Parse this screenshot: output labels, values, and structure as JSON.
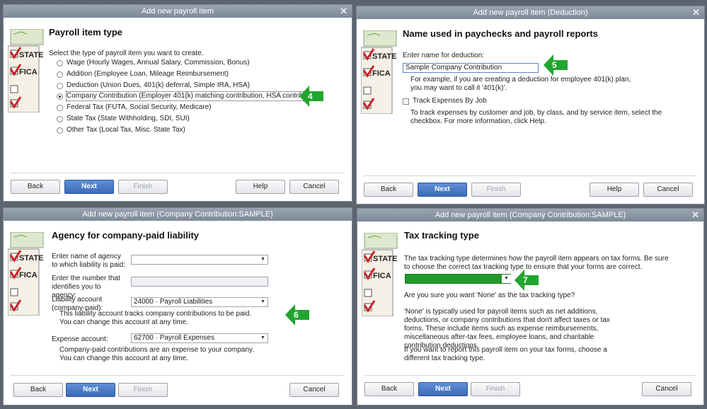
{
  "dialogs": {
    "d1": {
      "title": "Add new payroll item",
      "heading": "Payroll item type",
      "prompt": "Select the type of payroll item you want to create.",
      "options": [
        {
          "label": "Wage (Hourly Wages, Annual Salary, Commission, Bonus)"
        },
        {
          "label": "Addition (Employee Loan, Mileage Reimbursement)"
        },
        {
          "label": "Deduction (Union Dues, 401(k) deferral, Simple IRA, HSA)"
        },
        {
          "label": "Company Contribution (Employer 401(k) matching contribution, HSA contribution)"
        },
        {
          "label": "Federal Tax (FUTA, Social Security, Medicare)"
        },
        {
          "label": "State Tax (State Withholding, SDI, SUI)"
        },
        {
          "label": "Other Tax (Local Tax, Misc. State Tax)"
        }
      ],
      "selected_index": 3,
      "buttons": {
        "back": "Back",
        "next": "Next",
        "finish": "Finish",
        "help": "Help",
        "cancel": "Cancel"
      },
      "step": "4"
    },
    "d2": {
      "title": "Add new payroll item (Deduction)",
      "heading": "Name used in paychecks and payroll reports",
      "prompt": "Enter name for deduction:",
      "name_value": "Sample Company Contribution",
      "hint": "For example, if you are creating a deduction for employee 401(k) plan, you may want to call it '401(k)'.",
      "track_label": "Track Expenses By Job",
      "track_checked": false,
      "track_hint": "To track expenses by customer and job, by class, and by service item, select the checkbox. For more information, click Help.",
      "buttons": {
        "back": "Back",
        "next": "Next",
        "finish": "Finish",
        "help": "Help",
        "cancel": "Cancel"
      },
      "step": "5"
    },
    "d3": {
      "title": "Add new payroll item (Company Contribution:SAMPLE)",
      "heading": "Agency for company-paid liability",
      "agency_label": "Enter name of agency to which liability is paid:",
      "agency_value": "",
      "number_label": "Enter the number that identifies you to agency:",
      "number_value": "",
      "liability_label": "Liability account (company-paid):",
      "liability_value": "24000 · Payroll Liabilities",
      "liability_hint": "This liability account tracks company contributions to be paid. You can change this account at any time.",
      "expense_label": "Expense account:",
      "expense_value": "62700 · Payroll Expenses",
      "expense_hint": "Company-paid contributions are an expense to your company. You can change this account at any time.",
      "buttons": {
        "back": "Back",
        "next": "Next",
        "finish": "Finish",
        "cancel": "Cancel"
      },
      "step": "6"
    },
    "d4": {
      "title": "Add new payroll item (Company Contribution:SAMPLE)",
      "heading": "Tax tracking type",
      "intro": "The tax tracking type determines how the payroll item appears on tax forms. Be sure to choose the correct tax tracking type to ensure that your forms are correct.",
      "question": "Are you sure you want 'None' as the tax tracking type?",
      "explain": "'None' is typically used for payroll items such as net additions, deductions, or company contributions that don't affect taxes or tax forms. These include items such as expense reimbursements, miscellaneous after-tax fees, employee loans, and charitable contribution deductions.",
      "report": "If you want to report this payroll item on your tax forms, choose a different tax tracking type.",
      "buttons": {
        "back": "Back",
        "next": "Next",
        "finish": "Finish",
        "cancel": "Cancel"
      },
      "step": "7"
    }
  },
  "illustration": {
    "stamp1": "STATE",
    "stamp2": "FICA"
  },
  "colors": {
    "accent_green": "#1f9a2a",
    "primary_blue": "#3c6ab8",
    "titlebar": "#8591a0"
  }
}
